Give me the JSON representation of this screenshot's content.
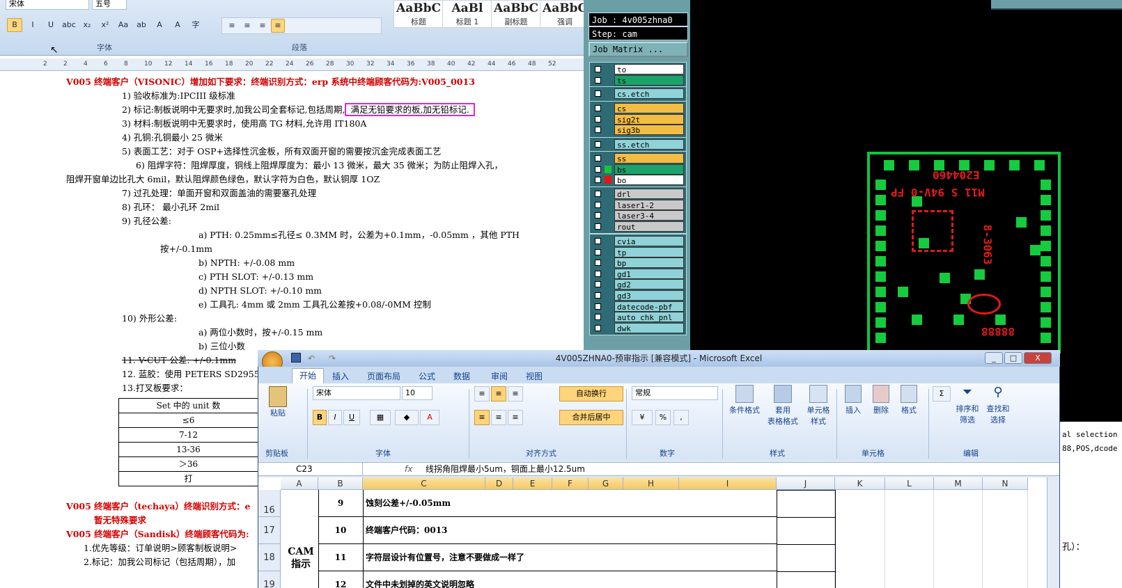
{
  "word": {
    "font_name": "宋体",
    "font_size": "五号",
    "fmt_buttons": [
      "B",
      "I",
      "U",
      "abc",
      "x₂",
      "x²",
      "Aa",
      "ab",
      "A",
      "A",
      "字"
    ],
    "group_font": "字体",
    "group_para": "段落",
    "styles": [
      {
        "sample": "AaBbC",
        "name": "标题"
      },
      {
        "sample": "AaBl",
        "name": "标题 1"
      },
      {
        "sample": "AaBbC",
        "name": "副标题"
      },
      {
        "sample": "AaBbC",
        "name": "强调"
      }
    ],
    "ruler_ticks": [
      "2",
      "2",
      "4",
      "6",
      "8",
      "10",
      "12",
      "14",
      "16",
      "18",
      "20",
      "22",
      "24",
      "26",
      "28",
      "30",
      "32",
      "34",
      "36",
      "38",
      "40",
      "42",
      "44",
      "46",
      "48",
      "52"
    ],
    "lines": [
      {
        "text": "V005 终端客户（VISONIC）增加如下要求：终端识别方式：erp 系统中终端顾客代码为:V005_0013",
        "red": true
      },
      {
        "text": "1)  验收标准为:IPCIII 级标准"
      },
      {
        "text": "2)  标记:制板说明中无要求时,加我公司全套标记,包括周期,",
        "hl": "满足无铅要求的板,加无铅标记."
      },
      {
        "text": "3)  材料:制板说明中无要求时，使用高 TG 材料,允许用 IT180A"
      },
      {
        "text": "4)  孔铜:孔铜最小 25 微米"
      },
      {
        "text": "5)  表面工艺：对于 OSP+选择性沉金板，所有双面开窗的需要按沉金完成表面工艺"
      },
      {
        "text": "6)  阻焊字符：阻焊厚度，铜线上阻焊厚度为：最小 13 微米，最大 35 微米；为防止阻焊入孔，"
      },
      {
        "text": "阻焊开窗单边比孔大 6mil，默认阻焊颜色绿色，默认字符为白色，默认铜厚 1OZ"
      },
      {
        "text": "7)  过孔处理：单面开窗和双面盖油的需要塞孔处理"
      },
      {
        "text": "8)  孔环： 最小孔环 2mil"
      },
      {
        "text": "9)  孔径公差:"
      },
      {
        "text": "a)  PTH:     0.25mm≤孔径≤ 0.3MM 时，公差为+0.1mm，-0.05mm  ，其他 PTH"
      },
      {
        "text": "按+/-0.1mm"
      },
      {
        "text": "b)  NPTH:   +/-0.08 mm"
      },
      {
        "text": "c)  PTH SLOT: +/-0.13 mm"
      },
      {
        "text": "d)  NPTH SLOT: +/-0.10 mm"
      },
      {
        "text": "e)  工具孔:   4mm  或  2mm 工具孔公差按+0.08/-0MM 控制"
      },
      {
        "text": "10) 外形公差:"
      },
      {
        "text": "a)  两位小数时，按+/-0.15 mm"
      },
      {
        "text": "b)  三位小数"
      },
      {
        "text": "11. V-CUT 公差: +/-0.1mm"
      },
      {
        "text": "12. 蓝胶：使用 PETERS SD2955"
      },
      {
        "text": "13.打叉板要求："
      },
      {
        "text": "V005 终端客户（techaya）终端识别方式：e",
        "red": true
      },
      {
        "text": "暂无特殊要求",
        "red": true
      },
      {
        "text": "V005 终端客户（Sandisk）终端顾客代码为:",
        "red": true
      },
      {
        "text": "1.优先等级：订单说明>顾客制板说明>"
      },
      {
        "text": "2.标记：加我公司标记（包括周期），加"
      }
    ],
    "table": [
      "Set 中的 unit 数",
      "≤6",
      "7-12",
      "13-36",
      "＞36",
      "打"
    ],
    "right_note": "孔）："
  },
  "cam": {
    "job": "Job : 4v005zhna0",
    "step": "Step: cam",
    "matrix": "Job Matrix ...",
    "layers": [
      {
        "name": "to",
        "color": "#ffffff"
      },
      {
        "name": "ts",
        "color": "#1aa36a"
      },
      {
        "name": "cs.etch",
        "color": "#8fd3d9"
      },
      {
        "name": "cs",
        "color": "#f2bd45"
      },
      {
        "name": "sig2t",
        "color": "#f2bd45"
      },
      {
        "name": "sig3b",
        "color": "#f2bd45"
      },
      {
        "name": "ss.etch",
        "color": "#8fd3d9"
      },
      {
        "name": "ss",
        "color": "#f2bd45"
      },
      {
        "name": "bs",
        "color": "#1aa36a"
      },
      {
        "name": "bo",
        "color": "#ffffff"
      },
      {
        "name": "drl",
        "color": "#c9c9c9"
      },
      {
        "name": "laser1-2",
        "color": "#c9c9c9"
      },
      {
        "name": "laser3-4",
        "color": "#c9c9c9"
      },
      {
        "name": "rout",
        "color": "#c9c9c9"
      },
      {
        "name": "cvia",
        "color": "#8fd3d9"
      },
      {
        "name": "tp",
        "color": "#8fd3d9"
      },
      {
        "name": "bp",
        "color": "#8fd3d9"
      },
      {
        "name": "gd1",
        "color": "#8fd3d9"
      },
      {
        "name": "gd2",
        "color": "#8fd3d9"
      },
      {
        "name": "gd3",
        "color": "#8fd3d9"
      },
      {
        "name": "datecode-pbf",
        "color": "#8fd3d9"
      },
      {
        "name": "auto_chk_pnl",
        "color": "#8fd3d9"
      },
      {
        "name": "dwk",
        "color": "#8fd3d9"
      }
    ],
    "silk_lines": [
      "E204460",
      "M11 S 94V-0 FP",
      "8-3063",
      "88888"
    ],
    "status": [
      "al selection",
      "88,POS,dcode"
    ]
  },
  "excel": {
    "title": "4V005ZHNA0-预审指示  [兼容模式] - Microsoft Excel",
    "tabs": [
      "开始",
      "插入",
      "页面布局",
      "公式",
      "数据",
      "审阅",
      "视图"
    ],
    "font": "宋体",
    "size": "10",
    "wrap": "自动换行",
    "merge": "合并后居中",
    "numfmt": "常规",
    "groups": [
      "剪贴板",
      "字体",
      "对齐方式",
      "数字",
      "样式",
      "单元格",
      "编辑"
    ],
    "btns": {
      "paste": "粘贴",
      "cond": "条件格式",
      "table": "套用\n表格格式",
      "cellstyle": "单元格\n样式",
      "insert": "插入",
      "delete": "删除",
      "format": "格式",
      "sort": "排序和\n筛选",
      "find": "查找和\n选择"
    },
    "namebox": "C23",
    "fx": "fx",
    "formula": "线拐角阻焊最小5um，铜面上最小12.5um",
    "cols": [
      "A",
      "B",
      "C",
      "D",
      "E",
      "F",
      "G",
      "H",
      "I",
      "J",
      "K",
      "L",
      "M",
      "N"
    ],
    "rows": [
      {
        "num": "16",
        "b": "9",
        "c": "蚀刻公差+/-0.05mm"
      },
      {
        "num": "17",
        "b": "10",
        "c": "终端客户代码：0013"
      },
      {
        "num": "18",
        "b": "11",
        "c": "字符层设计有位置号，注意不要做成一样了"
      },
      {
        "num": "19",
        "b": "12",
        "c": "文件中未划掉的英文说明忽略"
      }
    ],
    "a_label": "CAM 指示",
    "win": [
      "_",
      "□",
      "X"
    ]
  }
}
